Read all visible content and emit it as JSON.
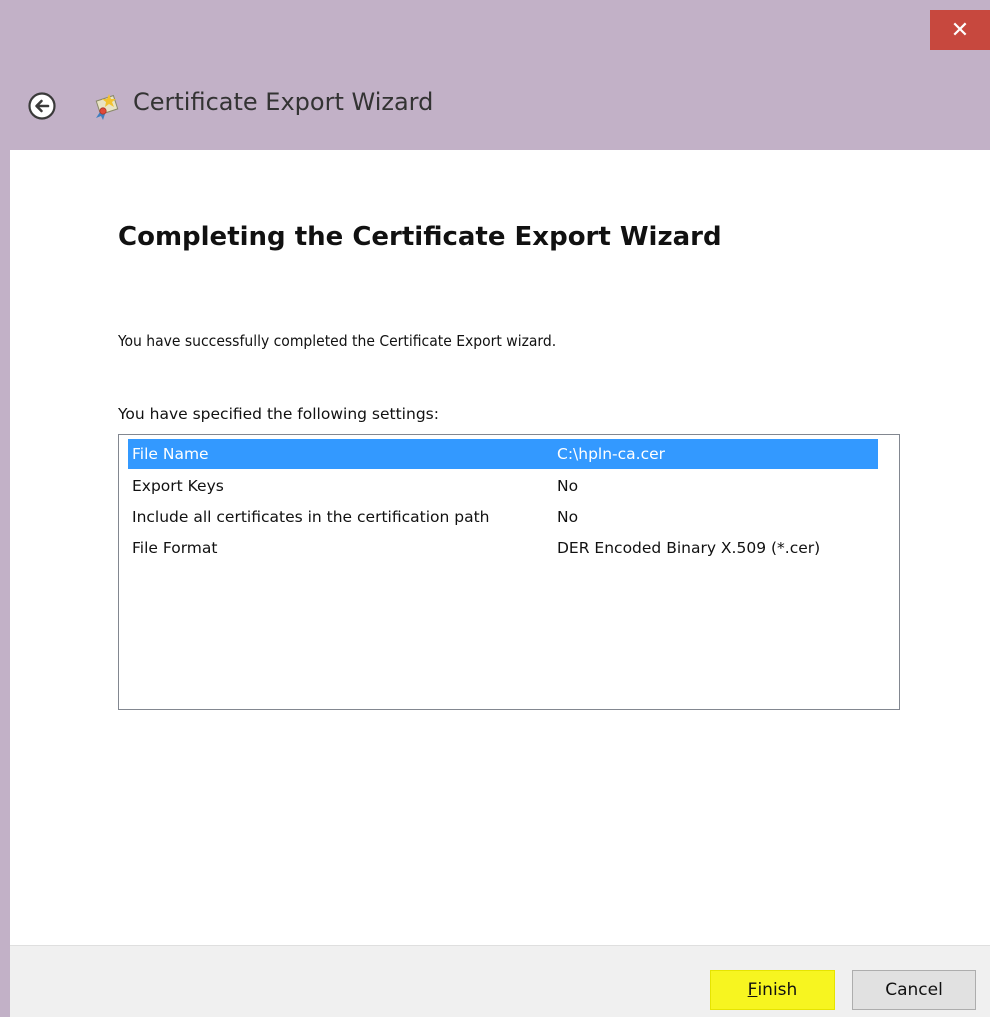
{
  "window": {
    "title": "Certificate Export Wizard",
    "close_label": "✕"
  },
  "main": {
    "heading": "Completing the Certificate Export Wizard",
    "success_text": "You have successfully completed the Certificate Export wizard.",
    "settings_label": "You have specified the following settings:",
    "settings": [
      {
        "name": "File Name",
        "value": "C:\\hpln-ca.cer",
        "selected": true
      },
      {
        "name": "Export Keys",
        "value": "No",
        "selected": false
      },
      {
        "name": "Include all certificates in the certification path",
        "value": "No",
        "selected": false
      },
      {
        "name": "File Format",
        "value": "DER Encoded Binary X.509 (*.cer)",
        "selected": false
      }
    ]
  },
  "footer": {
    "finish_label": "Finish",
    "finish_accesskey": "F",
    "finish_rest": "inish",
    "cancel_label": "Cancel"
  },
  "colors": {
    "titlebar": "#c2b1c7",
    "close_button": "#c7483e",
    "selection": "#3399ff",
    "finish_highlight": "#f7f520"
  }
}
